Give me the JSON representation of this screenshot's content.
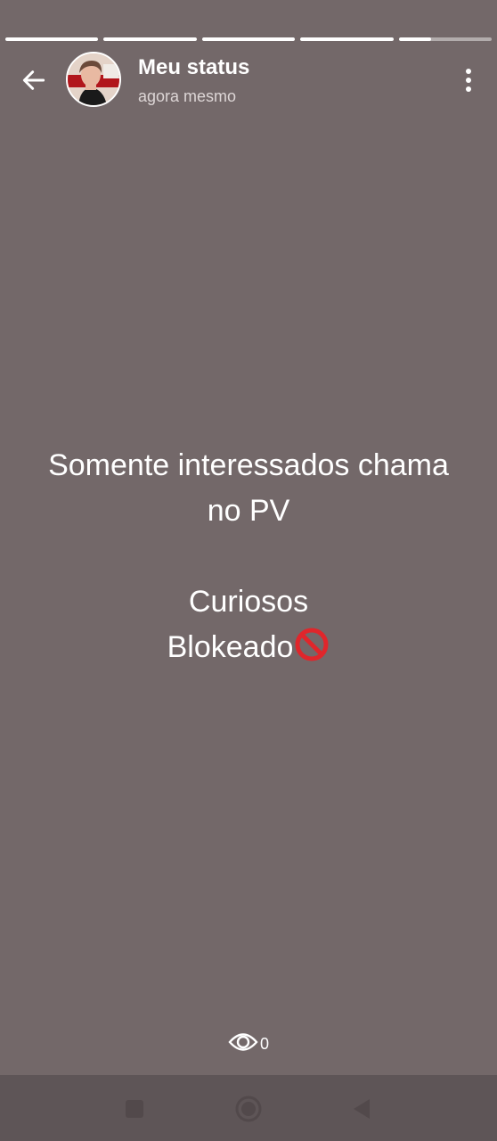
{
  "story": {
    "segment_count": 5,
    "current_segment_progress": 0.35,
    "current_segment_index": 4
  },
  "header": {
    "title": "Meu status",
    "subtitle": "agora mesmo",
    "back_icon": "arrow-left-icon",
    "menu_icon": "more-vertical-icon"
  },
  "status": {
    "line1": "Somente interessados chama",
    "line2": "no PV",
    "line3": "Curiosos",
    "line4": "Blokeado",
    "emoji": "🚫",
    "background_color": "#736869"
  },
  "views": {
    "icon": "eye-icon",
    "count": "0"
  },
  "navbar": {
    "items": [
      "recents-icon",
      "home-icon",
      "back-icon"
    ]
  }
}
